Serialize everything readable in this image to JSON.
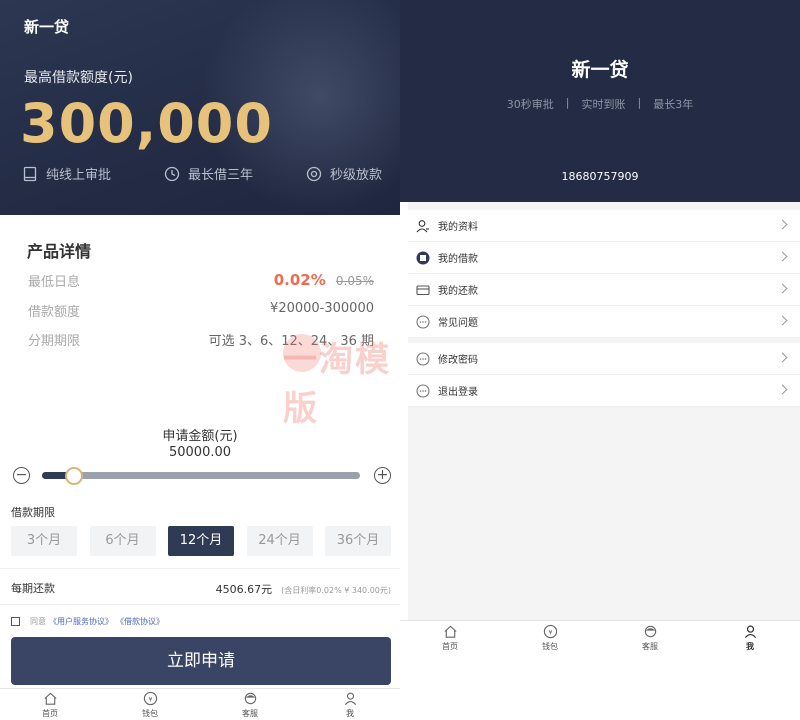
{
  "left": {
    "app_title": "新一贷",
    "hero_label": "最高借款额度(元)",
    "hero_amount": "300,000",
    "features": [
      {
        "icon": "tablet-icon",
        "label": "纯线上审批"
      },
      {
        "icon": "clock-icon",
        "label": "最长借三年"
      },
      {
        "icon": "target-icon",
        "label": "秒级放款"
      }
    ],
    "details": {
      "title": "产品详情",
      "rows": [
        {
          "key": "最低日息",
          "value_now": "0.02%",
          "value_old": "0.05%"
        },
        {
          "key": "借款额度",
          "value": "¥20000-300000"
        },
        {
          "key": "分期期限",
          "value": "可选 3、6、12、24、36 期"
        }
      ]
    },
    "watermark": "一淘模版",
    "apply": {
      "label": "申请金额(元)",
      "value": "50000.00",
      "slider_fraction": 0.1,
      "minus": "−",
      "plus": "+"
    },
    "term_label": "借款期限",
    "terms": [
      "3个月",
      "6个月",
      "12个月",
      "24个月",
      "36个月"
    ],
    "active_term": "12个月",
    "repay": {
      "label": "每期还款",
      "value": "4506.67元",
      "note": "(含日利率0.02% ¥ 340.00元)"
    },
    "agree": {
      "prefix": "同意",
      "link1": "《用户服务协议》",
      "link2": "《借款协议》"
    },
    "apply_button": "立即申请"
  },
  "tabs": [
    {
      "icon": "home-icon",
      "label": "首页"
    },
    {
      "icon": "wallet-icon",
      "label": "钱包"
    },
    {
      "icon": "service-icon",
      "label": "客服"
    },
    {
      "icon": "user-icon",
      "label": "我"
    }
  ],
  "right": {
    "title": "新一贷",
    "tags": [
      "30秒审批",
      "实时到账",
      "最长3年"
    ],
    "phone": "18680757909",
    "menu1": [
      {
        "icon": "profile-icon",
        "label": "我的资料"
      },
      {
        "icon": "loan-icon",
        "label": "我的借款"
      },
      {
        "icon": "repay-icon",
        "label": "我的还款"
      },
      {
        "icon": "faq-icon",
        "label": "常见问题"
      }
    ],
    "menu2": [
      {
        "icon": "password-icon",
        "label": "修改密码"
      },
      {
        "icon": "logout-icon",
        "label": "退出登录"
      }
    ]
  },
  "colors": {
    "hero_bg": "#232b45",
    "gold": "#e6c27a",
    "rate_red": "#f06b52",
    "primary_button": "#3a4464"
  }
}
